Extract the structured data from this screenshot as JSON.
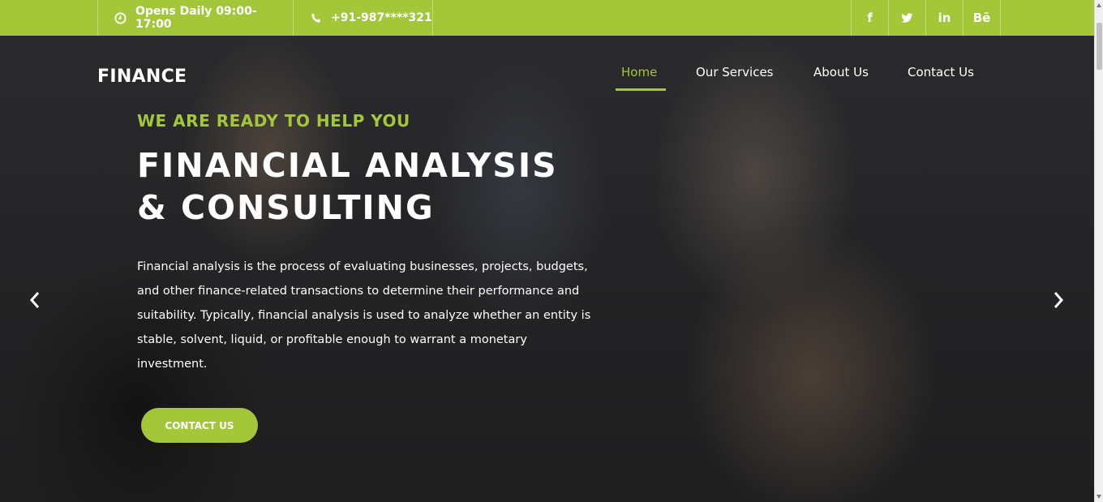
{
  "topbar": {
    "hours": "Opens Daily 09:00-17:00",
    "phone": "+91-987****321",
    "social": [
      "f",
      "t",
      "in",
      "Bē"
    ],
    "accent": "#a4c639"
  },
  "brand": "FINANCE",
  "nav": {
    "items": [
      "Home",
      "Our Services",
      "About Us",
      "Contact Us"
    ],
    "active": "Home"
  },
  "hero": {
    "eyebrow": "WE ARE READY TO HELP YOU",
    "headline_line1": "FINANCIAL ANALYSIS",
    "headline_line2": "& CONSULTING",
    "description_lines": [
      "Financial analysis is the process of evaluating businesses, projects, budgets,",
      "and other finance-related transactions to determine their performance and",
      "suitability. Typically, financial analysis is used to analyze whether an entity is",
      "stable, solvent, liquid, or profitable enough to warrant a monetary",
      "investment."
    ],
    "cta_label": "CONTACT US"
  },
  "icons": {
    "hours": "clock-icon",
    "phone": "phone-icon",
    "prev": "chevron-left-icon",
    "next": "chevron-right-icon"
  }
}
